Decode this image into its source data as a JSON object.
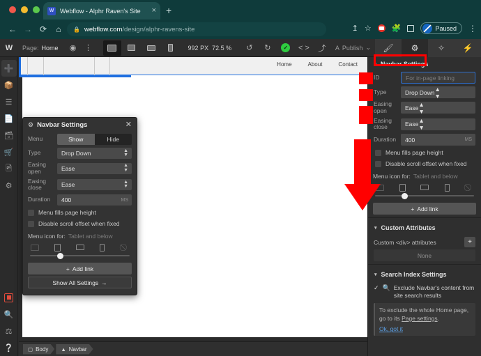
{
  "browser": {
    "tab": {
      "title": "Webflow - Alphr Raven's Site",
      "favicon": "webflow-favicon",
      "close": "×",
      "new_tab": "+"
    },
    "nav": {
      "back": "←",
      "forward": "→",
      "reload": "⟳",
      "home": "⌂"
    },
    "omnibox": {
      "lock": "🔒",
      "domain": "webflow.com",
      "path": "/design/alphr-ravens-site"
    },
    "toolbar_right": {
      "share": "↥",
      "bookmark": "☆",
      "extension_pin": "recording-extension-icon",
      "puzzle": "🧩",
      "sidepanel": "▢",
      "profile_status": "Paused",
      "menu": "⋮"
    }
  },
  "webflow": {
    "topbar": {
      "logo": "W",
      "page_label": "Page:",
      "page_name": "Home",
      "eye_icon": "◉",
      "more_icon": "⋮",
      "viewports": [
        "desktop-canvas",
        "desktop",
        "tablet",
        "mobile"
      ],
      "canvas_width": "992 PX",
      "zoom": "72.5 %",
      "undo": "↺",
      "redo": "↻",
      "status_check": "✓",
      "code_icon": "< >",
      "export_icon": "⤴",
      "publish_icon": "A",
      "publish_label": "Publish",
      "publish_caret": "⌄",
      "panel_tabs": [
        "style-panel",
        "settings-panel",
        "interactions-panel",
        "lightning-panel"
      ]
    },
    "left_rail": [
      "add-elements-icon",
      "components-icon",
      "navigator-icon",
      "pages-icon",
      "cms-icon",
      "ecommerce-icon",
      "assets-icon",
      "settings-icon",
      "video-record-icon",
      "search-icon",
      "audit-icon",
      "help-icon"
    ],
    "canvas": {
      "nav_links": [
        "Home",
        "About",
        "Contact"
      ]
    },
    "popover": {
      "gear_icon": "⚙",
      "title": "Navbar Settings",
      "close": "✕",
      "menu_label": "Menu",
      "menu_show": "Show",
      "menu_hide": "Hide",
      "type_label": "Type",
      "type_value": "Drop Down",
      "easing_open_label": "Easing open",
      "easing_open_value": "Ease",
      "easing_close_label": "Easing close",
      "easing_close_value": "Ease",
      "duration_label": "Duration",
      "duration_value": "400",
      "duration_unit": "MS",
      "checkbox_fills": "Menu fills page height",
      "checkbox_scroll": "Disable scroll offset when fixed",
      "menu_icon_for_label": "Menu icon for:",
      "menu_icon_for_value": "Tablet and below",
      "devices": [
        "desktop-icon",
        "tablet-icon",
        "tablet-landscape-icon",
        "mobile-icon",
        "hidden-icon"
      ],
      "add_link": "Add link",
      "add_link_plus": "+",
      "show_all": "Show All Settings",
      "show_all_arrow": "→"
    },
    "right_panel": {
      "header_icon": "⌂",
      "header_title": "Navbar Settings",
      "id_label": "ID",
      "id_placeholder": "For in-page linking",
      "type_label": "Type",
      "type_value": "Drop Down",
      "easing_open_label": "Easing open",
      "easing_open_value": "Ease",
      "easing_close_label": "Easing close",
      "easing_close_value": "Ease",
      "duration_label": "Duration",
      "duration_value": "400",
      "duration_unit": "MS",
      "checkbox_fills": "Menu fills page height",
      "checkbox_scroll": "Disable scroll offset when fixed",
      "menu_icon_for_label": "Menu icon for:",
      "menu_icon_for_value": "Tablet and below",
      "devices": [
        "desktop-icon",
        "tablet-icon",
        "tablet-landscape-icon",
        "mobile-icon",
        "hidden-icon"
      ],
      "add_link": "Add link",
      "add_link_plus": "+",
      "custom_attributes_title": "Custom Attributes",
      "custom_attributes_caret": "▾",
      "custom_div_label": "Custom <div> attributes",
      "custom_add": "+",
      "custom_none": "None",
      "search_index_title": "Search Index Settings",
      "search_index_caret": "▾",
      "exclude_check": "✓",
      "exclude_icon": "search-slash-icon",
      "exclude_text": "Exclude Navbar's content from site search results",
      "tip_text_1": "To exclude the whole Home page, go to its ",
      "tip_link": "Page settings",
      "tip_text_2": ".",
      "tip_ok": "Ok, got it"
    },
    "breadcrumb": [
      {
        "icon": "body-icon",
        "label": "Body"
      },
      {
        "icon": "navbar-icon",
        "label": "Navbar"
      }
    ]
  },
  "annotations": {
    "color": "#ff0000",
    "boxes": [
      "header-highlight",
      "id-row-highlight",
      "type-row-highlight",
      "easing-rows-highlight"
    ],
    "arrow": "down-arrow-pointing-to-menu-icon-settings"
  }
}
